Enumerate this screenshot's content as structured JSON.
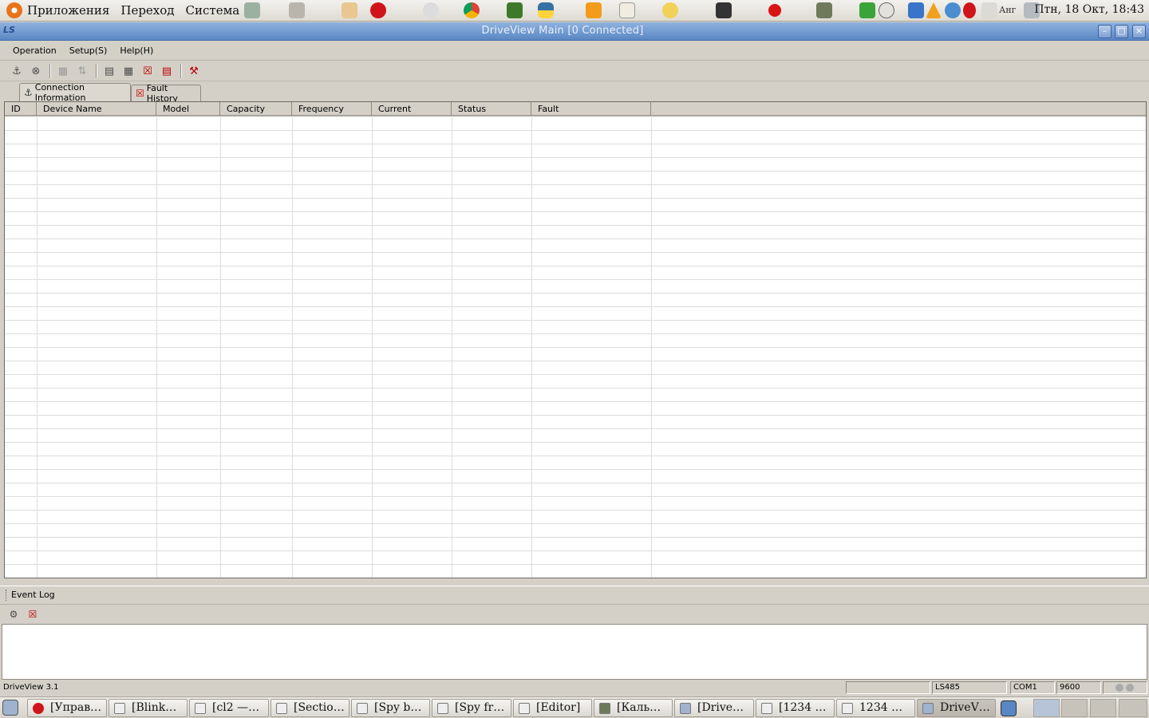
{
  "top_panel": {
    "menus": [
      "Приложения",
      "Переход",
      "Система"
    ],
    "keyboard_layout": "Анг",
    "clock": "Птн, 18 Окт, 18:43"
  },
  "window": {
    "title": "DriveView Main [0 Connected]",
    "app_icon": "LS"
  },
  "menubar": {
    "items": [
      "Operation",
      "Setup(S)",
      "Help(H)"
    ]
  },
  "tabs": [
    {
      "label": "Connection Information",
      "icon": "network-icon",
      "active": true
    },
    {
      "label": "Fault History",
      "icon": "fault-icon",
      "active": false
    }
  ],
  "grid": {
    "columns": [
      "ID",
      "Device Name",
      "Model",
      "Capacity",
      "Frequency",
      "Current",
      "Status",
      "Fault"
    ]
  },
  "event_log": {
    "title": "Event Log"
  },
  "statusbar": {
    "app_version": "DriveView 3.1",
    "protocol": "LS485",
    "port": "COM1",
    "baud": "9600"
  },
  "taskbar": {
    "tasks": [
      {
        "label": "[Управ…",
        "icon": "opera-icon"
      },
      {
        "label": "[Blink…",
        "icon": "editor-icon"
      },
      {
        "label": "[cl2 —…",
        "icon": "window-icon"
      },
      {
        "label": "[Sectio…",
        "icon": "window-icon"
      },
      {
        "label": "[Spy b…",
        "icon": "window-icon"
      },
      {
        "label": "[Spy fr…",
        "icon": "window-icon"
      },
      {
        "label": "[Editor]",
        "icon": "window-icon"
      },
      {
        "label": "[Каль…",
        "icon": "calculator-icon"
      },
      {
        "label": "[Drive…",
        "icon": "driveview-icon"
      },
      {
        "label": "[1234 …",
        "icon": "window-icon"
      },
      {
        "label": "1234 …",
        "icon": "window-icon"
      },
      {
        "label": "DriveV…",
        "icon": "driveview-icon",
        "active": true
      }
    ]
  }
}
